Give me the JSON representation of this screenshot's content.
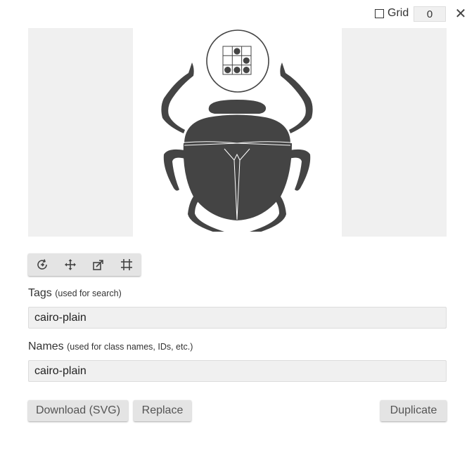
{
  "grid": {
    "label": "Grid",
    "checked": false,
    "value": "0"
  },
  "close": {
    "glyph": "✕"
  },
  "preview": {
    "icon": "scarab-beetle-glyph",
    "badge_icon": "glider-pattern-icon"
  },
  "toolbar": {
    "tools": [
      {
        "icon": "rotate-icon"
      },
      {
        "icon": "move-icon"
      },
      {
        "icon": "resize-icon"
      },
      {
        "icon": "crop-grid-icon"
      }
    ]
  },
  "tags": {
    "label": "Tags",
    "hint": "(used for search)",
    "value": "cairo-plain"
  },
  "names": {
    "label": "Names",
    "hint": "(used for class names, IDs, etc.)",
    "value": "cairo-plain"
  },
  "buttons": {
    "download": "Download (SVG)",
    "replace": "Replace",
    "duplicate": "Duplicate"
  },
  "colors": {
    "glyph": "#444444",
    "panel": "#f0f0f0",
    "button": "#e4e4e4"
  }
}
